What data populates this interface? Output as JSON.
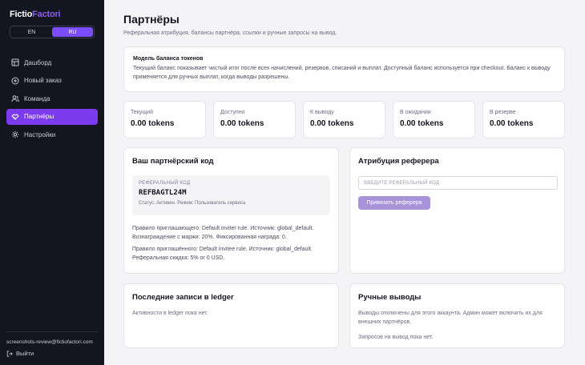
{
  "app": {
    "logo_part1": "Fictio",
    "logo_part2": "Factori"
  },
  "lang": {
    "en": "EN",
    "ru": "RU"
  },
  "sidebar": {
    "items": [
      {
        "label": "Дашборд",
        "icon": "dashboard-icon"
      },
      {
        "label": "Новый заказ",
        "icon": "plus-circle-icon"
      },
      {
        "label": "Команда",
        "icon": "users-icon"
      },
      {
        "label": "Партнёры",
        "icon": "partners-icon",
        "active": true
      },
      {
        "label": "Настройки",
        "icon": "gear-icon"
      }
    ],
    "user_email": "screenshots-review@fictiofactori.com",
    "logout_label": "Выйти"
  },
  "header": {
    "title": "Партнёры",
    "subtitle": "Реферальная атрибуция, балансы партнёра, ссылки и ручные запросы на вывод."
  },
  "model": {
    "title": "Модель баланса токенов",
    "text": "Текущий баланс показывает чистый итог после всех начислений, резервов, списаний и выплат. Доступный баланс используется при checkout. Баланс к выводу применяется для ручных выплат, когда выводы разрешены."
  },
  "stats": [
    {
      "label": "Текущий",
      "value": "0.00 tokens"
    },
    {
      "label": "Доступно",
      "value": "0.00 tokens"
    },
    {
      "label": "К выводу",
      "value": "0.00 tokens"
    },
    {
      "label": "В ожидании",
      "value": "0.00 tokens"
    },
    {
      "label": "В резерве",
      "value": "0.00 tokens"
    }
  ],
  "referral": {
    "title": "Ваш партнёрский код",
    "code_label": "РЕФЕРАЛЬНЫЙ КОД",
    "code": "REFBAGTL24M",
    "status": "Статус: Активен. Режим: Пользователь сервиса",
    "inviter_rule": "Правило приглашающего: Default inviter rule. Источник: global_default. Вознаграждение с маржи: 20%. Фиксированная награда: 0.",
    "invitee_rule": "Правило приглашённого: Default invitee rule. Источник: global_default. Реферальная скидка: 5% or 0 USD."
  },
  "attribution": {
    "title": "Атрибуция реферера",
    "input_placeholder": "ВВЕДИТЕ РЕФЕРАЛЬНЫЙ КОД",
    "button_label": "Привязать реферера"
  },
  "ledger": {
    "title": "Последние записи в ledger",
    "empty": "Активности в ledger пока нет."
  },
  "withdrawals": {
    "title": "Ручные выводы",
    "text": "Выводы отключены для этого аккаунта. Админ может включить их для внешних партнёров.",
    "empty": "Запросов на вывод пока нет."
  },
  "colors": {
    "accent": "#7c3aed",
    "sidebar_bg": "#14161f",
    "button_disabled": "#a893d8"
  }
}
